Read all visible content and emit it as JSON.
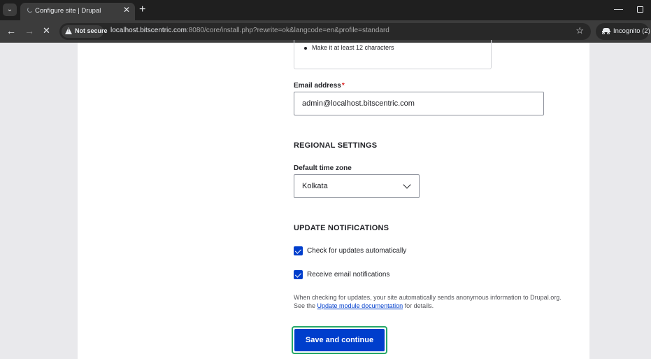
{
  "browser": {
    "tab_title": "Configure site | Drupal",
    "security_label": "Not secure",
    "url_host": "localhost.bitscentric.com",
    "url_rest": ":8080/core/install.php?rewrite=ok&langcode=en&profile=standard",
    "incognito_label": "Incognito (2)",
    "icons": [
      "tab-list-icon",
      "loading-spinner-icon",
      "close-icon",
      "plus-icon",
      "minimize-icon",
      "restore-icon",
      "back-arrow-icon",
      "forward-arrow-icon",
      "stop-icon",
      "warning-icon",
      "star-icon",
      "incognito-icon"
    ]
  },
  "form": {
    "password_hint": "Make it at least 12 characters",
    "email_label": "Email address",
    "required_marker": "*",
    "email_value": "admin@localhost.bitscentric.com",
    "regional_title": "REGIONAL SETTINGS",
    "timezone_label": "Default time zone",
    "timezone_value": "Kolkata",
    "updates_title": "UPDATE NOTIFICATIONS",
    "check_updates_label": "Check for updates automatically",
    "check_updates_checked": true,
    "email_notifications_label": "Receive email notifications",
    "email_notifications_checked": true,
    "help_text_1": "When checking for updates, your site automatically sends anonymous information to Drupal.org. See the ",
    "help_link": "Update module documentation",
    "help_text_2": " for details.",
    "submit_label": "Save and continue"
  },
  "colors": {
    "accent": "#003ecc",
    "focus_ring": "#26a769",
    "required": "#dc2323"
  }
}
